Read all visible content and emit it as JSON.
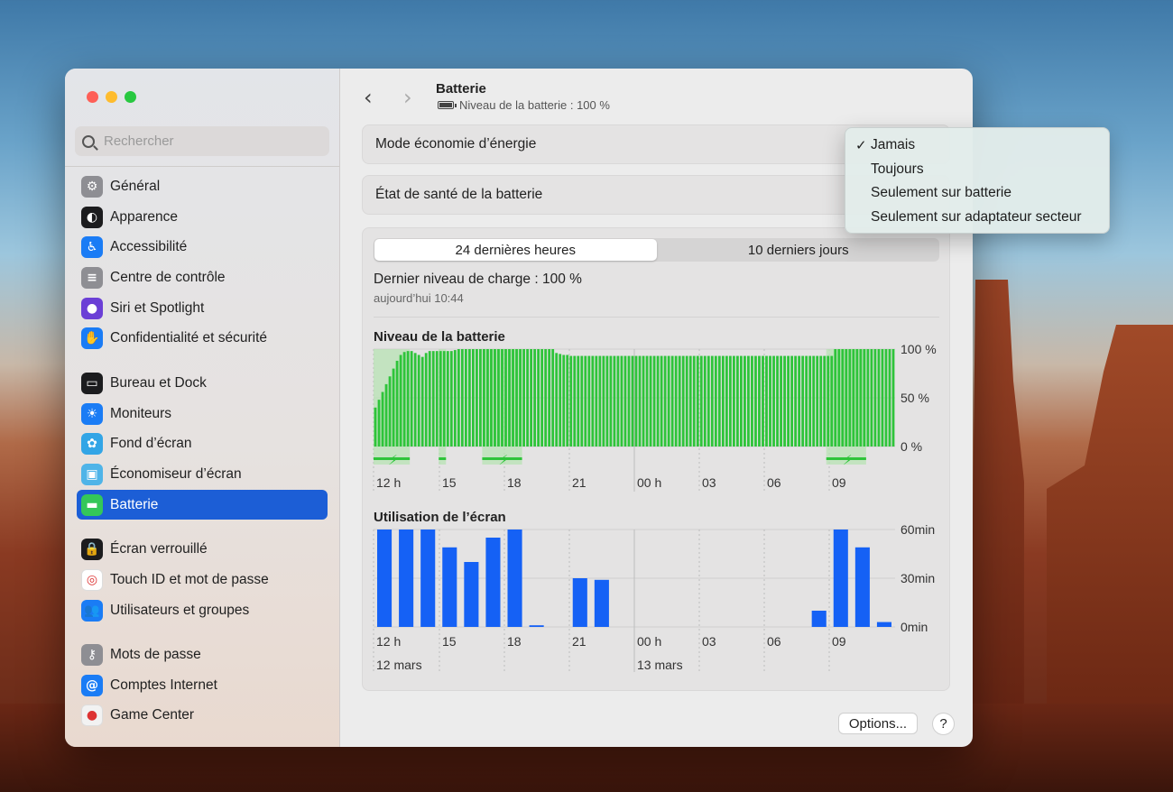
{
  "window": {
    "title": "Batterie",
    "subtitle": "Niveau de la batterie : 100 %"
  },
  "search": {
    "placeholder": "Rechercher"
  },
  "sidebar": {
    "items": [
      {
        "label": "Général",
        "icon": "gear-icon",
        "color": "#8e8e93",
        "glyph": "⚙"
      },
      {
        "label": "Apparence",
        "icon": "appearance-icon",
        "color": "#1c1c1e",
        "glyph": "◐"
      },
      {
        "label": "Accessibilité",
        "icon": "accessibility-icon",
        "color": "#1a7cf5",
        "glyph": "♿"
      },
      {
        "label": "Centre de contrôle",
        "icon": "control-center-icon",
        "color": "#8e8e93",
        "glyph": "≡"
      },
      {
        "label": "Siri et Spotlight",
        "icon": "siri-icon",
        "color": "#6b3fd6",
        "glyph": "●"
      },
      {
        "label": "Confidentialité et sécurité",
        "icon": "hand-icon",
        "color": "#1a7cf5",
        "glyph": "✋"
      },
      {
        "label": "Bureau et Dock",
        "icon": "dock-icon",
        "color": "#1c1c1e",
        "glyph": "▭"
      },
      {
        "label": "Moniteurs",
        "icon": "display-icon",
        "color": "#1a7cf5",
        "glyph": "☀"
      },
      {
        "label": "Fond d’écran",
        "icon": "wallpaper-icon",
        "color": "#32a5e6",
        "glyph": "✿"
      },
      {
        "label": "Économiseur d’écran",
        "icon": "screensaver-icon",
        "color": "#4fb4e8",
        "glyph": "▣"
      },
      {
        "label": "Batterie",
        "icon": "battery-icon",
        "color": "#34c759",
        "glyph": "▬"
      },
      {
        "label": "Écran verrouillé",
        "icon": "lock-icon",
        "color": "#1c1c1e",
        "glyph": "🔒"
      },
      {
        "label": "Touch ID et mot de passe",
        "icon": "fingerprint-icon",
        "color": "#ffffff",
        "glyph": "◎"
      },
      {
        "label": "Utilisateurs et groupes",
        "icon": "users-icon",
        "color": "#1a7cf5",
        "glyph": "👥"
      },
      {
        "label": "Mots de passe",
        "icon": "key-icon",
        "color": "#8e8e93",
        "glyph": "⚷"
      },
      {
        "label": "Comptes Internet",
        "icon": "at-icon",
        "color": "#1a7cf5",
        "glyph": "@"
      },
      {
        "label": "Game Center",
        "icon": "game-center-icon",
        "color": "#f2f2f2",
        "glyph": "●"
      }
    ]
  },
  "settings": {
    "low_power_label": "Mode économie d’énergie",
    "health_label": "État de santé de la batterie"
  },
  "dropdown": {
    "options": [
      "Jamais",
      "Toujours",
      "Seulement sur batterie",
      "Seulement sur adaptateur secteur"
    ],
    "selected": "Jamais"
  },
  "tabs": {
    "tab1": "24 dernières heures",
    "tab2": "10 derniers jours",
    "active": "24 dernières heures"
  },
  "last_charge": {
    "title": "Dernier niveau de charge : 100 %",
    "time": "aujourd’hui 10:44"
  },
  "buttons": {
    "options": "Options...",
    "help": "?"
  },
  "chart_data": [
    {
      "type": "bar",
      "title": "Niveau de la batterie",
      "y_ticks": [
        "100 %",
        "50 %",
        "0 %"
      ],
      "x_ticks": [
        "12 h",
        "15",
        "18",
        "21",
        "00 h",
        "03",
        "06",
        "09"
      ],
      "ylim": [
        0,
        100
      ],
      "color": "#2ec43a",
      "values": [
        40,
        48,
        56,
        64,
        72,
        80,
        88,
        94,
        97,
        98,
        98,
        96,
        94,
        92,
        96,
        98,
        98,
        98,
        98,
        98,
        98,
        98,
        99,
        100,
        100,
        100,
        100,
        100,
        100,
        100,
        100,
        100,
        100,
        100,
        100,
        100,
        100,
        100,
        100,
        100,
        100,
        100,
        100,
        100,
        100,
        100,
        100,
        100,
        100,
        100,
        96,
        95,
        94,
        94,
        93,
        93,
        93,
        93,
        93,
        93,
        93,
        93,
        93,
        93,
        93,
        93,
        93,
        93,
        93,
        93,
        93,
        93,
        93,
        93,
        93,
        93,
        93,
        93,
        93,
        93,
        93,
        93,
        93,
        93,
        93,
        93,
        93,
        93,
        93,
        93,
        93,
        93,
        93,
        93,
        93,
        93,
        93,
        93,
        93,
        93,
        93,
        93,
        93,
        93,
        93,
        93,
        93,
        93,
        93,
        93,
        93,
        93,
        93,
        93,
        93,
        93,
        93,
        93,
        93,
        93,
        93,
        93,
        93,
        93,
        93,
        93,
        93,
        100,
        100,
        100,
        100,
        100,
        100,
        100,
        100,
        100,
        100,
        100,
        100,
        100,
        100,
        100,
        100,
        100
      ],
      "charging_periods": [
        [
          0,
          10
        ],
        [
          18,
          20
        ],
        [
          30,
          41
        ],
        [
          125,
          136
        ]
      ]
    },
    {
      "type": "bar",
      "title": "Utilisation de l’écran",
      "y_ticks": [
        "60min",
        "30min",
        "0min"
      ],
      "x_ticks": [
        "12 h",
        "15",
        "18",
        "21",
        "00 h",
        "03",
        "06",
        "09"
      ],
      "date_labels": [
        "12 mars",
        "13 mars"
      ],
      "ylim": [
        0,
        60
      ],
      "color": "#1561f5",
      "values": [
        60,
        60,
        60,
        49,
        40,
        55,
        60,
        1,
        0,
        30,
        29,
        0,
        0,
        0,
        0,
        0,
        0,
        0,
        0,
        0,
        10,
        60,
        49,
        3
      ]
    }
  ]
}
